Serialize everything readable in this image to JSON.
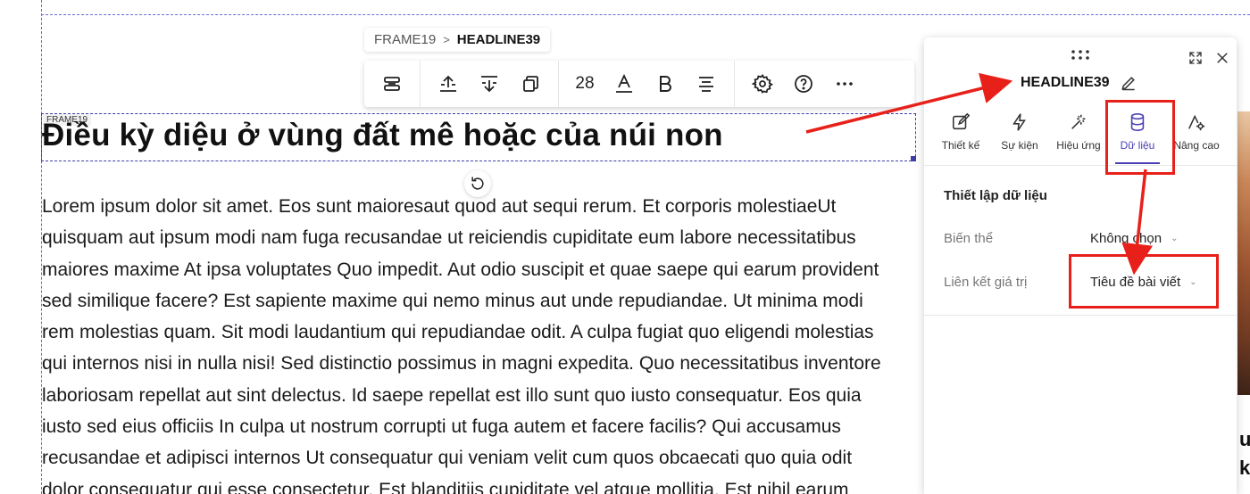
{
  "breadcrumb": {
    "parent": "FRAME19",
    "separator": ">",
    "current": "HEADLINE39"
  },
  "toolbar": {
    "font_size": "28",
    "buttons": [
      "layout-icon",
      "move-up-icon",
      "move-down-icon",
      "duplicate-icon",
      "text-color-icon",
      "bold-icon",
      "align-icon",
      "settings-icon",
      "help-icon",
      "more-icon"
    ]
  },
  "canvas": {
    "frame_label": "FRAME19",
    "headline": "Điều kỳ diệu ở vùng đất mê hoặc của núi non",
    "body_lines": [
      "Lorem ipsum dolor sit amet. Eos sunt maioresaut quod aut sequi rerum. Et corporis molestiaeUt",
      "quisquam aut ipsum modi nam fuga recusandae ut reiciendis cupiditate eum labore necessitatibus",
      "maiores maxime At ipsa voluptates Quo impedit. Aut odio suscipit et quae saepe qui earum provident",
      "sed similique facere? Est sapiente maxime qui nemo minus aut unde repudiandae. Ut minima modi",
      "rem molestias quam. Sit modi laudantium qui repudiandae odit. A culpa fugiat quo eligendi molestias",
      "qui internos nisi in nulla nisi! Sed distinctio possimus in magni expedita. Quo necessitatibus inventore",
      "laboriosam repellat aut sint delectus. Id saepe repellat est illo sunt quo iusto consequatur. Eos quia",
      "iusto sed eius officiis In culpa ut nostrum corrupti ut fuga autem et facere facilis? Qui accusamus",
      "recusandae et adipisci internos Ut consequatur qui veniam velit cum quos obcaecati quo quia odit",
      "dolor consequatur qui esse consectetur. Est blanditiis cupiditate vel atque mollitia. Est nihil earum"
    ],
    "right_partial_a": "u",
    "right_partial_b": "k"
  },
  "panel": {
    "title": "HEADLINE39",
    "tabs": [
      {
        "label": "Thiết kế",
        "icon": "design-icon"
      },
      {
        "label": "Sự kiện",
        "icon": "lightning-icon"
      },
      {
        "label": "Hiệu ứng",
        "icon": "magic-wand-icon"
      },
      {
        "label": "Dữ liệu",
        "icon": "database-icon",
        "active": true
      },
      {
        "label": "Nâng cao",
        "icon": "advanced-gear-icon"
      }
    ],
    "section_title": "Thiết lập dữ liệu",
    "variant_label": "Biến thể",
    "variant_value": "Không chọn",
    "binding_label": "Liên kết giá trị",
    "binding_value": "Tiêu đề bài viết"
  },
  "colors": {
    "accent": "#4a3fb5",
    "annotation": "#e8201a",
    "guide": "#6b6bd6"
  }
}
